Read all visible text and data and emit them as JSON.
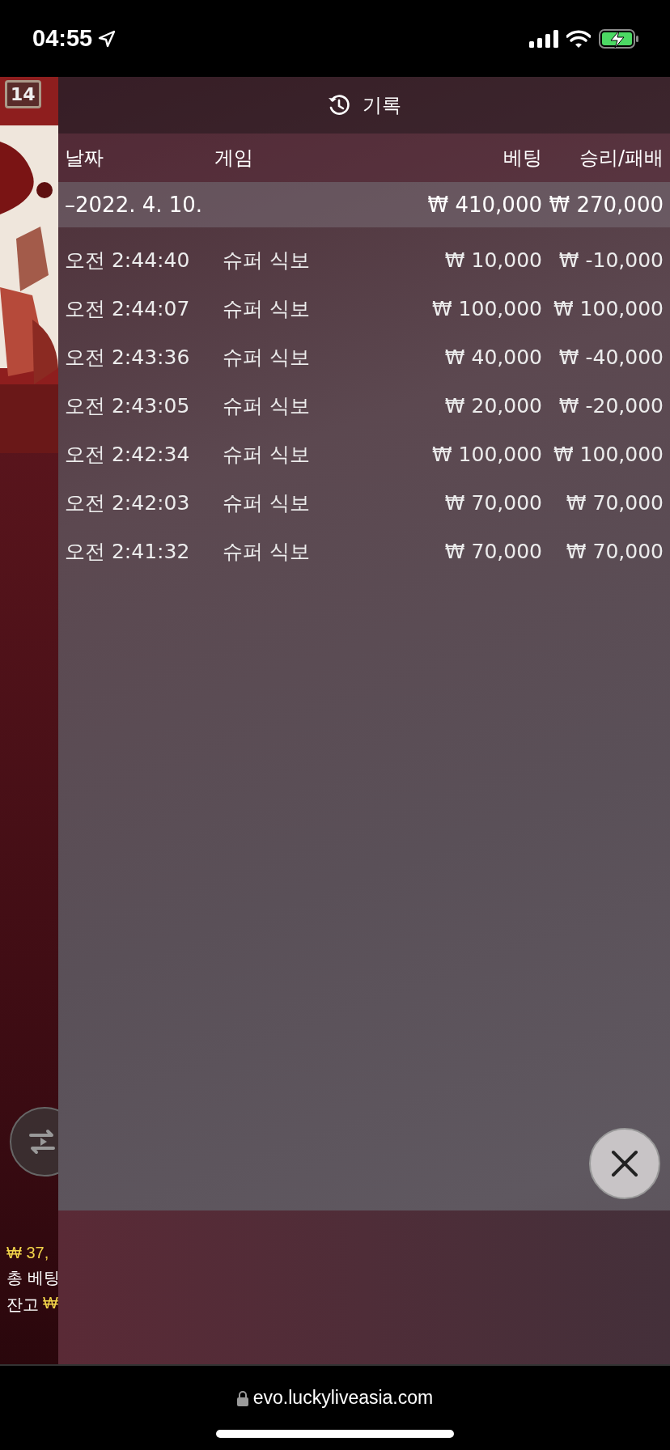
{
  "status_bar": {
    "time": "04:55"
  },
  "side": {
    "badge": "14",
    "balance_prefix": "₩ 37,",
    "bet_label": "총 베팅",
    "balance_label": "잔고",
    "balance_currency": "₩"
  },
  "history": {
    "title": "기록",
    "columns": [
      "날짜",
      "게임",
      "베팅",
      "승리/패배"
    ],
    "summary": {
      "date": "–2022. 4. 10.",
      "bet": "₩ 410,000",
      "result": "₩ 270,000"
    },
    "rows": [
      {
        "time": "오전 2:44:40",
        "game": "슈퍼 식보",
        "bet": "₩ 10,000",
        "result": "₩ -10,000"
      },
      {
        "time": "오전 2:44:07",
        "game": "슈퍼 식보",
        "bet": "₩ 100,000",
        "result": "₩ 100,000"
      },
      {
        "time": "오전 2:43:36",
        "game": "슈퍼 식보",
        "bet": "₩ 40,000",
        "result": "₩ -40,000"
      },
      {
        "time": "오전 2:43:05",
        "game": "슈퍼 식보",
        "bet": "₩ 20,000",
        "result": "₩ -20,000"
      },
      {
        "time": "오전 2:42:34",
        "game": "슈퍼 식보",
        "bet": "₩ 100,000",
        "result": "₩ 100,000"
      },
      {
        "time": "오전 2:42:03",
        "game": "슈퍼 식보",
        "bet": "₩ 70,000",
        "result": "₩ 70,000"
      },
      {
        "time": "오전 2:41:32",
        "game": "슈퍼 식보",
        "bet": "₩ 70,000",
        "result": "₩ 70,000"
      }
    ]
  },
  "browser": {
    "url": "evo.luckyliveasia.com"
  }
}
